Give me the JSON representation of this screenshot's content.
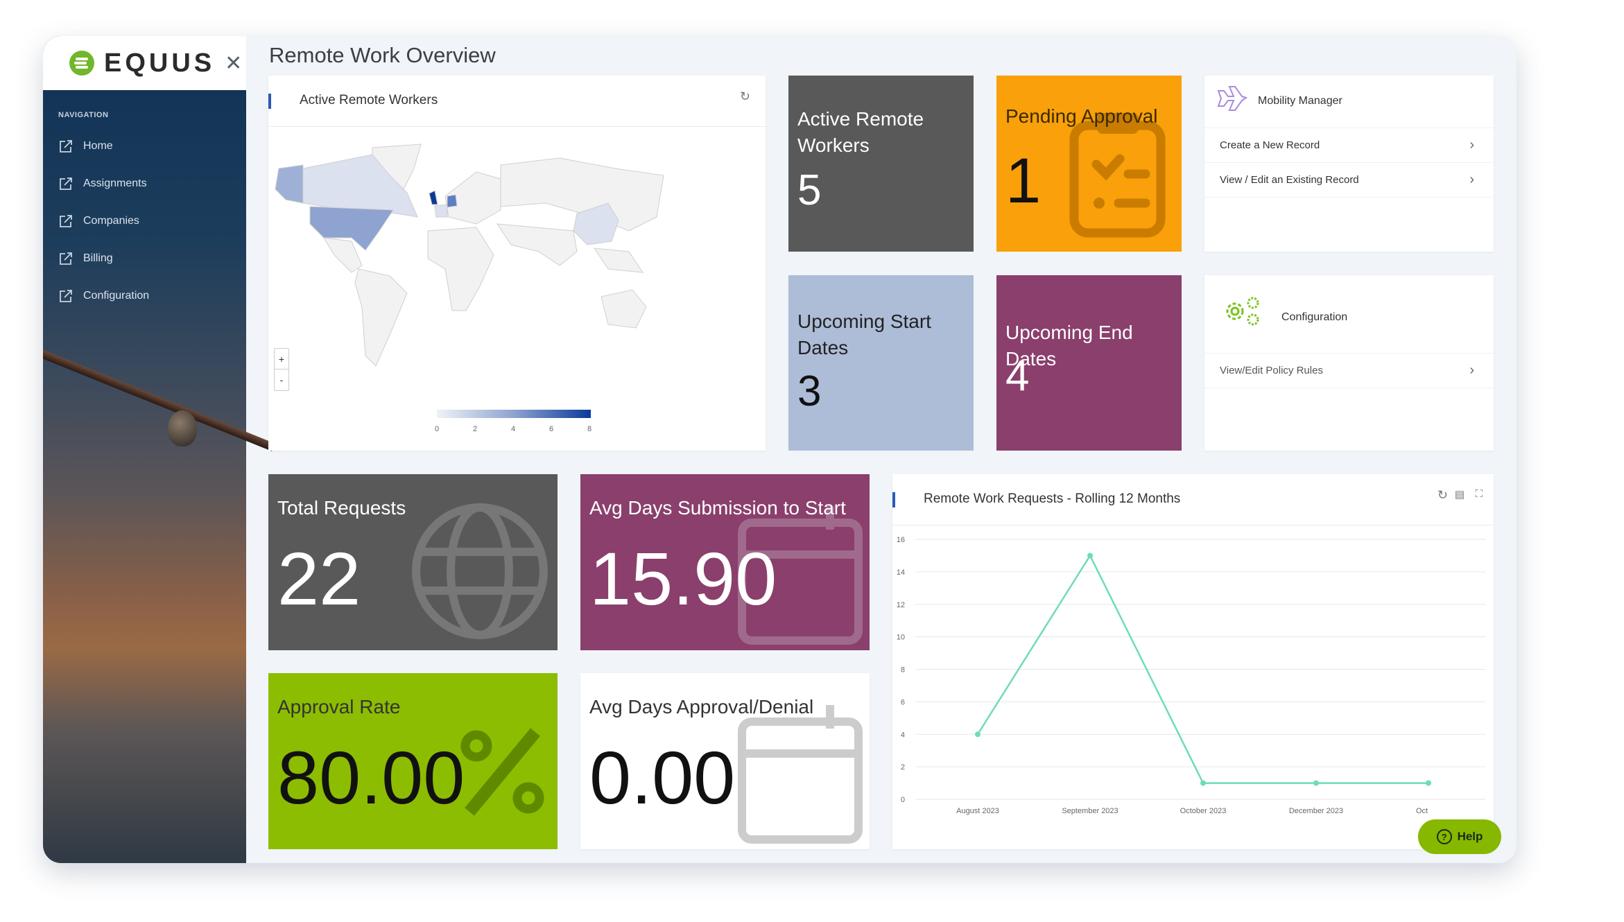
{
  "brand": {
    "name": "EQUUS",
    "logo_color": "#72b62b"
  },
  "sidebar": {
    "heading": "NAVIGATION",
    "items": [
      {
        "label": "Home"
      },
      {
        "label": "Assignments"
      },
      {
        "label": "Companies"
      },
      {
        "label": "Billing"
      },
      {
        "label": "Configuration"
      }
    ]
  },
  "page": {
    "title": "Remote Work Overview"
  },
  "map_panel": {
    "title": "Active Remote Workers",
    "zoom_in": "+",
    "zoom_out": "-",
    "legend_ticks": [
      "0",
      "2",
      "4",
      "6",
      "8"
    ],
    "countries": [
      {
        "name": "United Kingdom",
        "value": 8
      },
      {
        "name": "Germany",
        "value": 5
      },
      {
        "name": "United States",
        "value": 3
      },
      {
        "name": "Alaska",
        "value": 3
      },
      {
        "name": "Canada",
        "value": 1
      },
      {
        "name": "France",
        "value": 1
      },
      {
        "name": "Italy",
        "value": 1
      },
      {
        "name": "China",
        "value": 1
      }
    ],
    "scale_colors": [
      "#f0f2f7",
      "#0b3a9a"
    ]
  },
  "tiles": {
    "active_workers": {
      "label": "Active Remote Workers",
      "value": "5",
      "color": "#595959"
    },
    "pending_approval": {
      "label": "Pending Approval",
      "value": "1",
      "color": "#f9a00a"
    },
    "upcoming_start": {
      "label": "Upcoming Start Dates",
      "value": "3",
      "color": "#adbdd8"
    },
    "upcoming_end": {
      "label": "Upcoming End Dates",
      "value": "4",
      "color": "#8a3f6c"
    },
    "total_requests": {
      "label": "Total Requests",
      "value": "22",
      "color": "#595959"
    },
    "avg_submission": {
      "label": "Avg Days Submission to Start",
      "value": "15.90",
      "color": "#8a3f6c"
    },
    "approval_rate": {
      "label": "Approval Rate",
      "value": "80.00",
      "color": "#8cbd00"
    },
    "avg_approval": {
      "label": "Avg Days Approval/Denial",
      "value": "0.00",
      "color": "#ffffff"
    }
  },
  "mobility": {
    "title": "Mobility Manager",
    "links": [
      {
        "label": "Create a New Record"
      },
      {
        "label": "View / Edit an Existing Record"
      }
    ]
  },
  "configuration": {
    "title": "Configuration",
    "links": [
      {
        "label": "View/Edit Policy Rules"
      }
    ]
  },
  "chart_data": {
    "type": "line",
    "title": "Remote Work Requests - Rolling 12 Months",
    "categories": [
      "August 2023",
      "September 2023",
      "October 2023",
      "December 2023",
      "Oct"
    ],
    "values": [
      4,
      15,
      1,
      1,
      1
    ],
    "ylim": [
      0,
      16
    ],
    "yticks": [
      "0",
      "2",
      "4",
      "6",
      "8",
      "10",
      "12",
      "14",
      "16"
    ],
    "grid": true,
    "color": "#6ddcb8"
  },
  "help": {
    "label": "Help"
  }
}
